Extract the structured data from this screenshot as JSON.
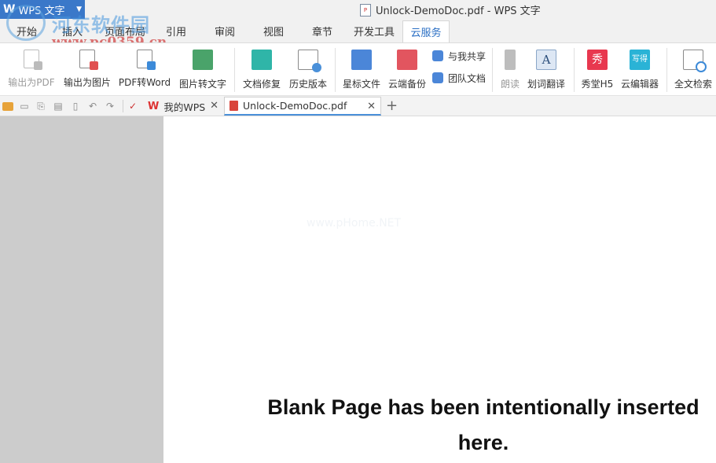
{
  "app": {
    "button_label": "WPS 文字",
    "window_title": "Unlock-DemoDoc.pdf - WPS 文字"
  },
  "watermark": {
    "site_name": "河东软件园",
    "url": "www.pc0359.cn",
    "page_watermark": "www.pHome.NET"
  },
  "menu_tabs": [
    {
      "label": "开始"
    },
    {
      "label": "插入"
    },
    {
      "label": "页面布局"
    },
    {
      "label": "引用"
    },
    {
      "label": "审阅"
    },
    {
      "label": "视图"
    },
    {
      "label": "章节"
    },
    {
      "label": "开发工具"
    },
    {
      "label": "云服务",
      "active": true
    }
  ],
  "ribbon": {
    "buttons": [
      {
        "label": "输出为PDF",
        "icon": "export-pdf-icon",
        "disabled": true
      },
      {
        "label": "输出为图片",
        "icon": "export-image-icon"
      },
      {
        "label": "PDF转Word",
        "icon": "pdf-to-word-icon"
      },
      {
        "label": "图片转文字",
        "icon": "image-to-text-icon"
      },
      {
        "label": "文档修复",
        "icon": "doc-repair-icon"
      },
      {
        "label": "历史版本",
        "icon": "history-icon"
      },
      {
        "label": "星标文件",
        "icon": "starred-folder-icon"
      },
      {
        "label": "云端备份",
        "icon": "cloud-backup-icon"
      },
      {
        "label": "朗读",
        "icon": "microphone-icon",
        "disabled": true
      },
      {
        "label": "划词翻译",
        "icon": "translate-icon"
      },
      {
        "label": "秀堂H5",
        "icon": "xiutang-icon"
      },
      {
        "label": "云编辑器",
        "icon": "cloud-editor-icon"
      },
      {
        "label": "全文检索",
        "icon": "fulltext-search-icon"
      }
    ],
    "small_buttons": [
      {
        "label": "与我共享",
        "icon": "shared-with-me-icon"
      },
      {
        "label": "团队文档",
        "icon": "team-docs-icon"
      }
    ],
    "icon_text": {
      "xiu": "秀",
      "xiede": "写得",
      "a": "A"
    }
  },
  "doc_tabs": [
    {
      "label": "我的WPS",
      "icon": "wps-logo-icon"
    },
    {
      "label": "Unlock-DemoDoc.pdf",
      "icon": "pdf-file-icon",
      "active": true
    }
  ],
  "document": {
    "body_text": "Blank Page has been intentionally inserted here."
  },
  "colors": {
    "accent": "#3a78c9",
    "active_tab_text": "#2b6fc4",
    "gutter": "#cccccc"
  }
}
